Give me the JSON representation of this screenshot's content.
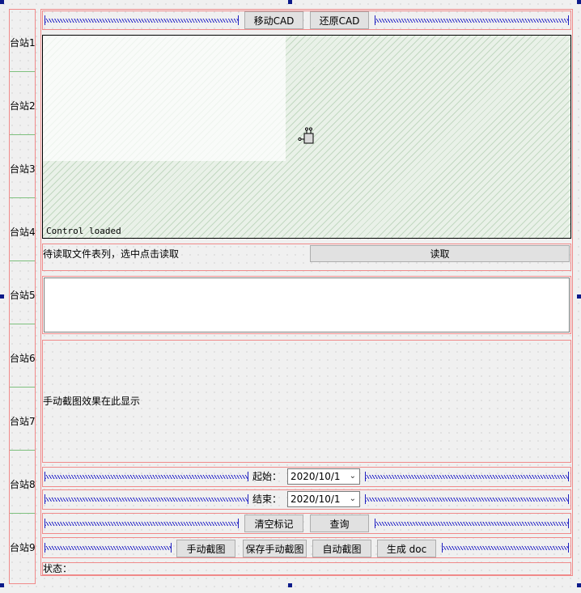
{
  "stations": [
    "台站1",
    "台站2",
    "台站3",
    "台站4",
    "台站5",
    "台站6",
    "台站7",
    "台站8",
    "台站9"
  ],
  "toolbar": {
    "move_cad": "移动CAD",
    "restore_cad": "还原CAD"
  },
  "cad": {
    "status_text": "Control loaded",
    "icon": "activex-control-icon"
  },
  "file_row": {
    "prompt": "待读取文件表列，选中点击读取",
    "read_button": "读取"
  },
  "preview": {
    "text": "手动截图效果在此显示"
  },
  "date_range": {
    "start_label": "起始：",
    "start_value": "2020/10/1",
    "end_label": "结束：",
    "end_value": "2020/10/1"
  },
  "actions": {
    "clear_marks": "清空标记",
    "query": "查询"
  },
  "capture": {
    "manual": "手动截图",
    "save_manual": "保存手动截图",
    "auto": "自动截图",
    "generate_doc": "生成 doc"
  },
  "status": {
    "label": "状态："
  },
  "colors": {
    "layout_border": "#f08a8a",
    "spacer": "#2828c8",
    "cad_bg": "#e9f1e8",
    "separator": "#7ec07e",
    "handle": "#0c1a8a"
  }
}
